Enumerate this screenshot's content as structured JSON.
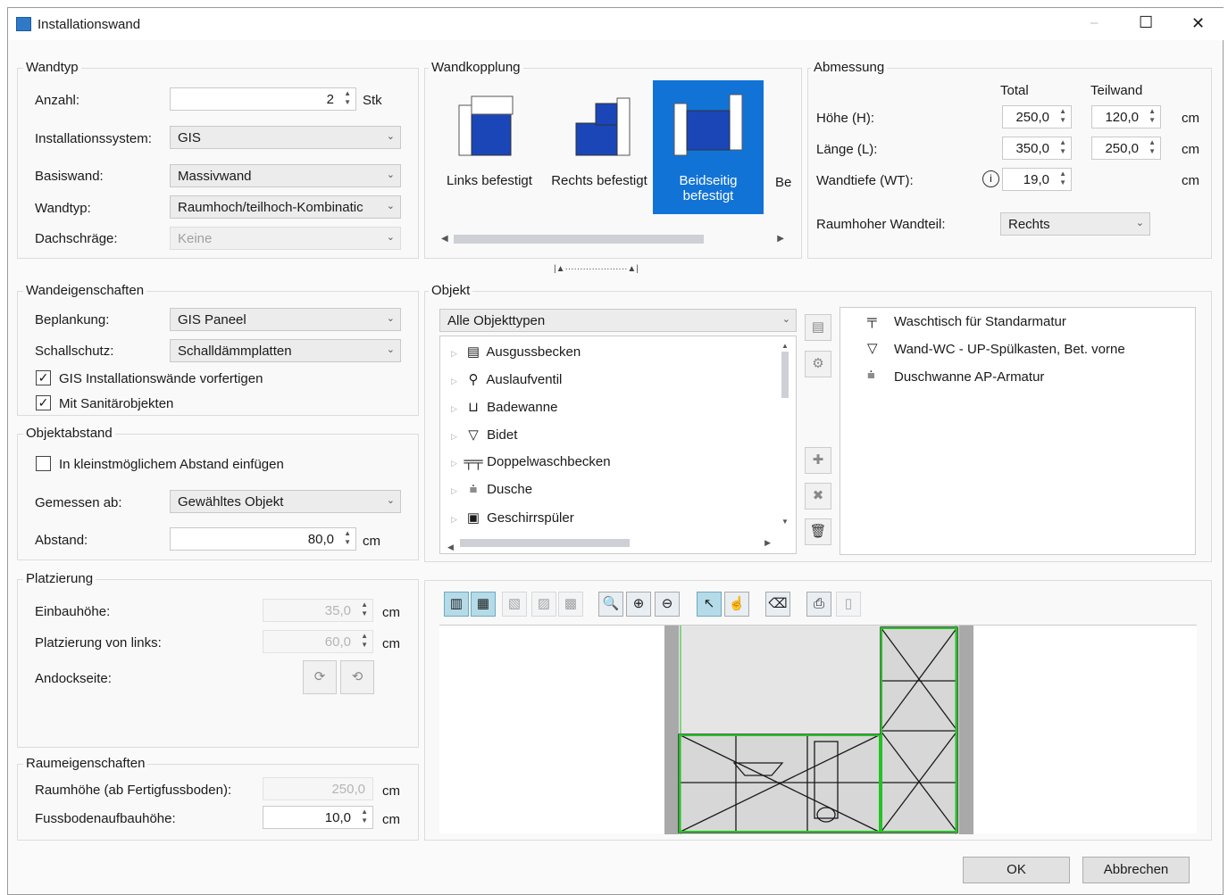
{
  "window": {
    "title": "Installationswand",
    "minimize_icon": "–",
    "maximize_icon": "☐",
    "close_icon": "✕"
  },
  "wandtyp": {
    "legend": "Wandtyp",
    "anzahl_label": "Anzahl:",
    "anzahl_value": "2",
    "anzahl_unit": "Stk",
    "installationssystem_label": "Installationssystem:",
    "installationssystem_value": "GIS",
    "basiswand_label": "Basiswand:",
    "basiswand_value": "Massivwand",
    "wandtyp_label": "Wandtyp:",
    "wandtyp_value": "Raumhoch/teilhoch-Kombinatic",
    "dachschraege_label": "Dachschräge:",
    "dachschraege_value": "Keine"
  },
  "wandkopplung": {
    "legend": "Wandkopplung",
    "options": [
      "Links befestigt",
      "Rechts befestigt",
      "Beidseitig befestigt",
      "Be"
    ],
    "selected": "Beidseitig befestigt"
  },
  "abmessung": {
    "legend": "Abmessung",
    "col_total": "Total",
    "col_teilwand": "Teilwand",
    "hoehe_label": "Höhe (H):",
    "hoehe_total": "250,0",
    "hoehe_teil": "120,0",
    "laenge_label": "Länge (L):",
    "laenge_total": "350,0",
    "laenge_teil": "250,0",
    "wandtiefe_label": "Wandtiefe (WT):",
    "wandtiefe_total": "19,0",
    "unit": "cm",
    "raumhoher_label": "Raumhoher Wandteil:",
    "raumhoher_value": "Rechts"
  },
  "wandeigenschaften": {
    "legend": "Wandeigenschaften",
    "beplankung_label": "Beplankung:",
    "beplankung_value": "GIS Paneel",
    "schallschutz_label": "Schallschutz:",
    "schallschutz_value": "Schalldämmplatten",
    "chk_vorfertigen": "GIS Installationswände vorfertigen",
    "chk_sanitaer": "Mit Sanitärobjekten"
  },
  "objektabstand": {
    "legend": "Objektabstand",
    "chk_kleinst": "In kleinstmöglichem Abstand einfügen",
    "gemessen_label": "Gemessen ab:",
    "gemessen_value": "Gewähltes Objekt",
    "abstand_label": "Abstand:",
    "abstand_value": "80,0",
    "unit": "cm"
  },
  "platzierung": {
    "legend": "Platzierung",
    "einbauhoehe_label": "Einbauhöhe:",
    "einbauhoehe_value": "35,0",
    "von_links_label": "Platzierung von links:",
    "von_links_value": "60,0",
    "andockseite_label": "Andockseite:",
    "unit": "cm"
  },
  "raumeigenschaften": {
    "legend": "Raumeigenschaften",
    "raumhoehe_label": "Raumhöhe (ab Fertigfussboden):",
    "raumhoehe_value": "250,0",
    "fussboden_label": "Fussbodenaufbauhöhe:",
    "fussboden_value": "10,0",
    "unit": "cm"
  },
  "objekt": {
    "legend": "Objekt",
    "filter_value": "Alle Objekttypen",
    "tree": [
      "Ausgussbecken",
      "Auslaufventil",
      "Badewanne",
      "Bidet",
      "Doppelwaschbecken",
      "Dusche",
      "Geschirrspüler"
    ],
    "selected_objects": [
      "Waschtisch für Standarmatur",
      "Wand-WC - UP-Spülkasten, Bet. vorne",
      "Duschwanne AP-Armatur"
    ]
  },
  "buttons": {
    "ok": "OK",
    "cancel": "Abbrechen"
  },
  "colors": {
    "accent": "#1273d6",
    "plan_green": "#22c322"
  }
}
